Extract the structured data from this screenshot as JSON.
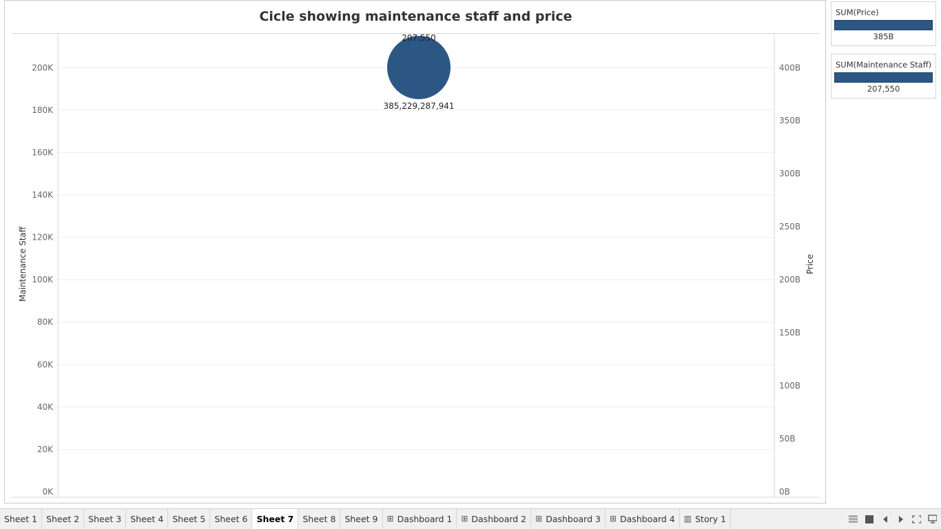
{
  "chart_data": {
    "type": "scatter",
    "title": "Cicle showing maintenance staff and price",
    "ylabel_left": "Maintenance Staff",
    "ylabel_right": "Price",
    "left_axis": {
      "ylim": [
        0,
        216000
      ],
      "ticks": [
        0,
        20000,
        40000,
        60000,
        80000,
        100000,
        120000,
        140000,
        160000,
        180000,
        200000
      ],
      "tick_labels": [
        "0K",
        "20K",
        "40K",
        "60K",
        "80K",
        "100K",
        "120K",
        "140K",
        "160K",
        "180K",
        "200K"
      ]
    },
    "right_axis": {
      "ylim": [
        0,
        432000000000
      ],
      "ticks": [
        0,
        50000000000,
        100000000000,
        150000000000,
        200000000000,
        250000000000,
        300000000000,
        350000000000,
        400000000000
      ],
      "tick_labels": [
        "0B",
        "50B",
        "100B",
        "150B",
        "200B",
        "250B",
        "300B",
        "350B",
        "400B"
      ]
    },
    "points": [
      {
        "maintenance_staff": 207550,
        "price": 385229287941,
        "label_staff": "207,550",
        "label_price": "385,229,287,941"
      }
    ],
    "grid": true,
    "color": "#2c5784"
  },
  "legends": [
    {
      "title": "SUM(Price)",
      "value": "385B"
    },
    {
      "title": "SUM(Maintenance Staff)",
      "value": "207,550"
    }
  ],
  "tabs": [
    {
      "label": "Sheet 1",
      "icon": ""
    },
    {
      "label": "Sheet 2",
      "icon": ""
    },
    {
      "label": "Sheet 3",
      "icon": ""
    },
    {
      "label": "Sheet 4",
      "icon": ""
    },
    {
      "label": "Sheet 5",
      "icon": ""
    },
    {
      "label": "Sheet 6",
      "icon": ""
    },
    {
      "label": "Sheet 7",
      "icon": "",
      "active": true
    },
    {
      "label": "Sheet 8",
      "icon": ""
    },
    {
      "label": "Sheet 9",
      "icon": ""
    },
    {
      "label": "Dashboard 1",
      "icon": "dashboard-icon"
    },
    {
      "label": "Dashboard 2",
      "icon": "dashboard-icon"
    },
    {
      "label": "Dashboard 3",
      "icon": "dashboard-icon"
    },
    {
      "label": "Dashboard 4",
      "icon": "dashboard-icon"
    },
    {
      "label": "Story 1",
      "icon": "story-icon"
    }
  ],
  "controls": [
    "show-sheet-sorter-icon",
    "show-tabs-icon",
    "previous-sheet-icon",
    "next-sheet-icon",
    "fit-screen-icon",
    "presentation-mode-icon"
  ]
}
